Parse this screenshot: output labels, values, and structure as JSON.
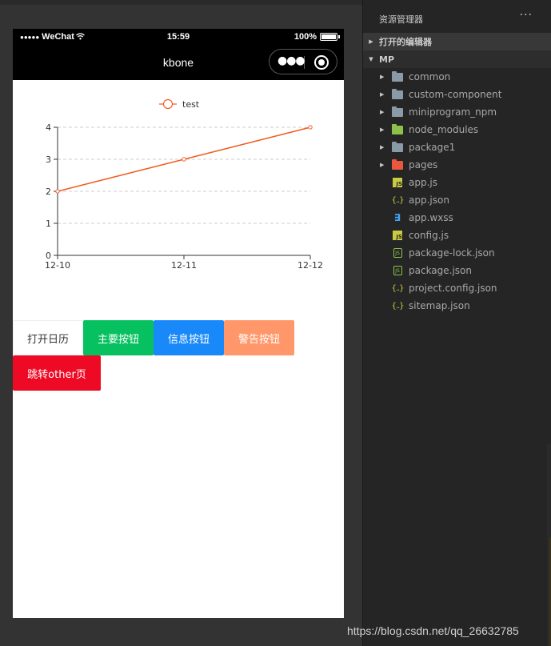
{
  "phone": {
    "status": {
      "carrier": "WeChat",
      "signal_dots": "●●●●●",
      "time": "15:59",
      "battery": "100%"
    },
    "nav_title": "kbone",
    "buttons": {
      "calendar": "打开日历",
      "primary": "主要按钮",
      "info": "信息按钮",
      "warning": "警告按钮",
      "danger": "跳转other页"
    }
  },
  "chart_data": {
    "type": "line",
    "categories": [
      "12-10",
      "12-11",
      "12-12"
    ],
    "series": [
      {
        "name": "test",
        "values": [
          2,
          3,
          4
        ],
        "color": "#f05f24"
      }
    ],
    "ylim": [
      0,
      4
    ],
    "yticks": [
      "0",
      "1",
      "2",
      "3",
      "4"
    ],
    "legend": "top-center",
    "grid": "horizontal-dashed"
  },
  "explorer": {
    "title": "资源管理器",
    "more": "···",
    "open_editors": "打开的编辑器",
    "project": "MP",
    "items": [
      {
        "label": "common",
        "icon": "folder-icon",
        "expandable": true
      },
      {
        "label": "custom-component",
        "icon": "folder-icon",
        "expandable": true
      },
      {
        "label": "miniprogram_npm",
        "icon": "folder-icon",
        "expandable": true
      },
      {
        "label": "node_modules",
        "icon": "node-folder-icon",
        "expandable": true
      },
      {
        "label": "package1",
        "icon": "folder-icon",
        "expandable": true
      },
      {
        "label": "pages",
        "icon": "pages-folder-icon",
        "expandable": true
      },
      {
        "label": "app.js",
        "icon": "js-file-icon",
        "expandable": false
      },
      {
        "label": "app.json",
        "icon": "json-file-icon",
        "expandable": false
      },
      {
        "label": "app.wxss",
        "icon": "css-file-icon",
        "expandable": false
      },
      {
        "label": "config.js",
        "icon": "js-file-icon",
        "expandable": false
      },
      {
        "label": "package-lock.json",
        "icon": "node-file-icon",
        "expandable": false
      },
      {
        "label": "package.json",
        "icon": "node-file-icon",
        "expandable": false
      },
      {
        "label": "project.config.json",
        "icon": "json-file-icon",
        "expandable": false
      },
      {
        "label": "sitemap.json",
        "icon": "json-file-icon",
        "expandable": false
      }
    ]
  },
  "watermark": "https://blog.csdn.net/qq_26632785"
}
